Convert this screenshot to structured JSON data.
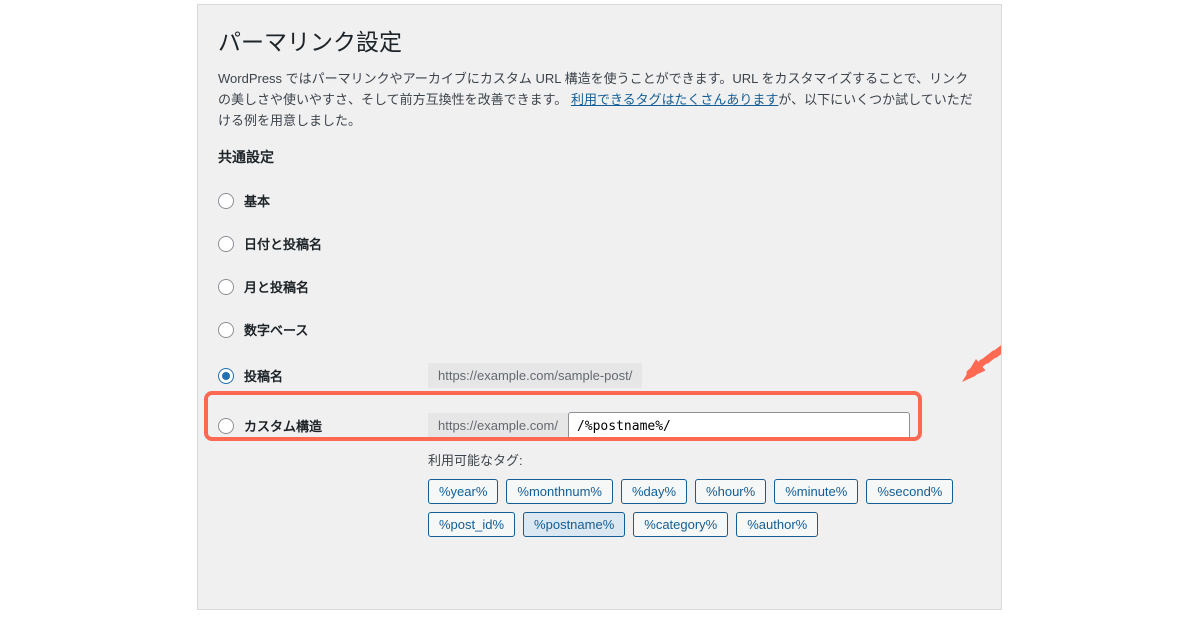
{
  "page": {
    "title": "パーマリンク設定",
    "intro_before": "WordPress ではパーマリンクやアーカイブにカスタム URL 構造を使うことができます。URL をカスタマイズすることで、リンクの美しさや使いやすさ、そして前方互換性を改善できます。",
    "link_text": "利用できるタグはたくさんあります",
    "intro_after": "が、以下にいくつか試していただける例を用意しました。",
    "section_title": "共通設定"
  },
  "options": [
    {
      "id": "default",
      "label": "基本",
      "checked": false,
      "sample": ""
    },
    {
      "id": "datepost",
      "label": "日付と投稿名",
      "checked": false,
      "sample": ""
    },
    {
      "id": "monthpost",
      "label": "月と投稿名",
      "checked": false,
      "sample": ""
    },
    {
      "id": "numeric",
      "label": "数字ベース",
      "checked": false,
      "sample": ""
    },
    {
      "id": "postname",
      "label": "投稿名",
      "checked": true,
      "sample": "https://example.com/sample-post/"
    }
  ],
  "custom": {
    "label": "カスタム構造",
    "base": "https://example.com/",
    "value": "/%postname%/",
    "tag_caption": "利用可能なタグ:",
    "tags": [
      {
        "text": "%year%",
        "active": false
      },
      {
        "text": "%monthnum%",
        "active": false
      },
      {
        "text": "%day%",
        "active": false
      },
      {
        "text": "%hour%",
        "active": false
      },
      {
        "text": "%minute%",
        "active": false
      },
      {
        "text": "%second%",
        "active": false
      },
      {
        "text": "%post_id%",
        "active": false
      },
      {
        "text": "%postname%",
        "active": true
      },
      {
        "text": "%category%",
        "active": false
      },
      {
        "text": "%author%",
        "active": false
      }
    ]
  }
}
